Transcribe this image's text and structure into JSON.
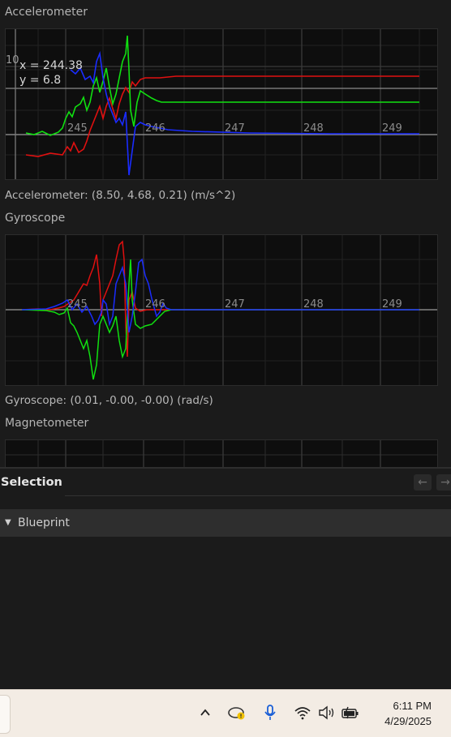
{
  "accelerometer": {
    "title": "Accelerometer",
    "readout": "Accelerometer: (8.50, 4.68, 0.21) (m/s^2)",
    "ytick": "10",
    "cursor_x": "x = 244.38",
    "cursor_y": "y = 6.8",
    "xticks": [
      "245",
      "246",
      "247",
      "248",
      "249"
    ]
  },
  "gyroscope": {
    "title": "Gyroscope",
    "readout": "Gyroscope: (0.01, -0.00, -0.00) (rad/s)",
    "xticks": [
      "245",
      "246",
      "247",
      "248",
      "249"
    ]
  },
  "magnetometer": {
    "title": "Magnetometer"
  },
  "selection": {
    "label": "Selection",
    "back_icon": "←",
    "forward_icon": "→"
  },
  "blueprint": {
    "label": "Blueprint",
    "caret": "▼"
  },
  "taskbar": {
    "time": "6:11 PM",
    "date": "4/29/2025"
  },
  "colors": {
    "x_axis": "#e01010",
    "y_axis": "#10e010",
    "z_axis": "#1020e0"
  }
}
